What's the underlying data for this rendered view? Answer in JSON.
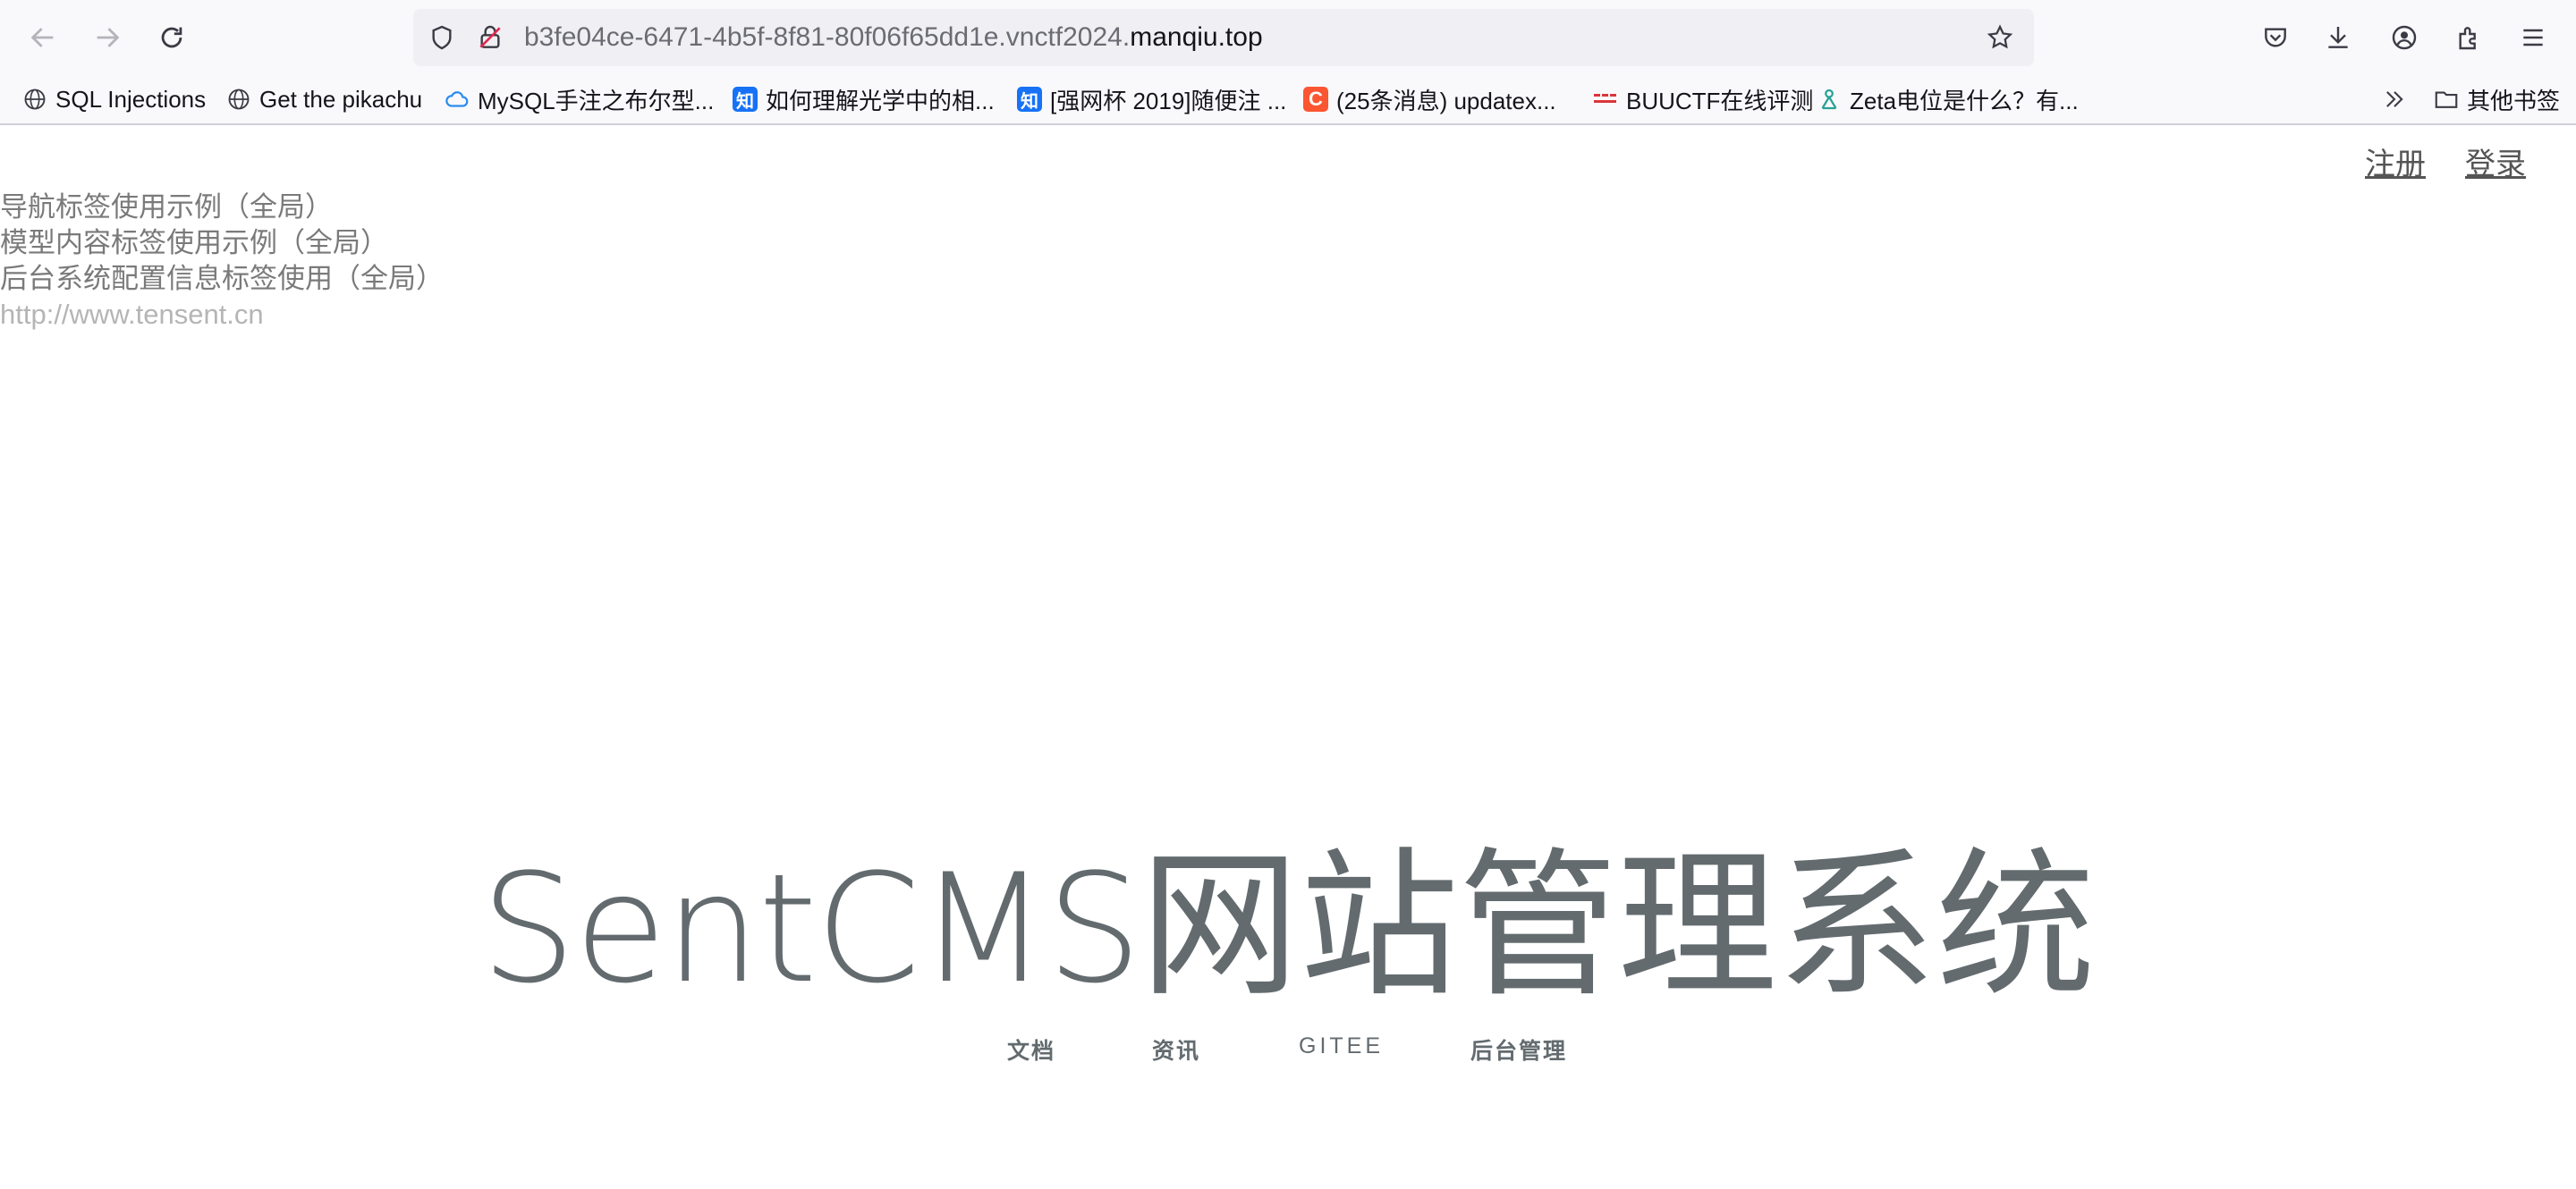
{
  "browser": {
    "url_prefix": "b3fe04ce-6471-4b5f-8f81-80f06f65dd1e.vnctf2024.",
    "url_host": "manqiu.top",
    "bookmarks": [
      {
        "label": "SQL Injections",
        "icon": "globe-icon"
      },
      {
        "label": "Get the pikachu",
        "icon": "globe-icon"
      },
      {
        "label": "MySQL手注之布尔型...",
        "icon": "cloud-icon"
      },
      {
        "label": "如何理解光学中的相...",
        "icon": "zhihu-icon",
        "badge": "知"
      },
      {
        "label": "[强网杯 2019]随便注 ...",
        "icon": "zhihu-icon",
        "badge": "知"
      },
      {
        "label": "(25条消息) updatex...",
        "icon": "csdn-icon",
        "badge": "C"
      },
      {
        "label": "BUUCTF在线评测",
        "icon": "buuctf-icon"
      },
      {
        "label": "Zeta电位是什么？有...",
        "icon": "zeta-icon"
      }
    ],
    "other_bookmarks": "其他书签"
  },
  "page": {
    "auth": {
      "register": "注册",
      "login": "登录"
    },
    "menu": [
      "导航标签使用示例（全局）",
      "模型内容标签使用示例（全局）",
      "后台系统配置信息标签使用（全局）"
    ],
    "site_url": "http://www.tensent.cn",
    "hero": {
      "en": "SentCMS",
      "cn": "网站管理系统"
    },
    "links": [
      "文档",
      "资讯",
      "GITEE",
      "后台管理"
    ]
  }
}
